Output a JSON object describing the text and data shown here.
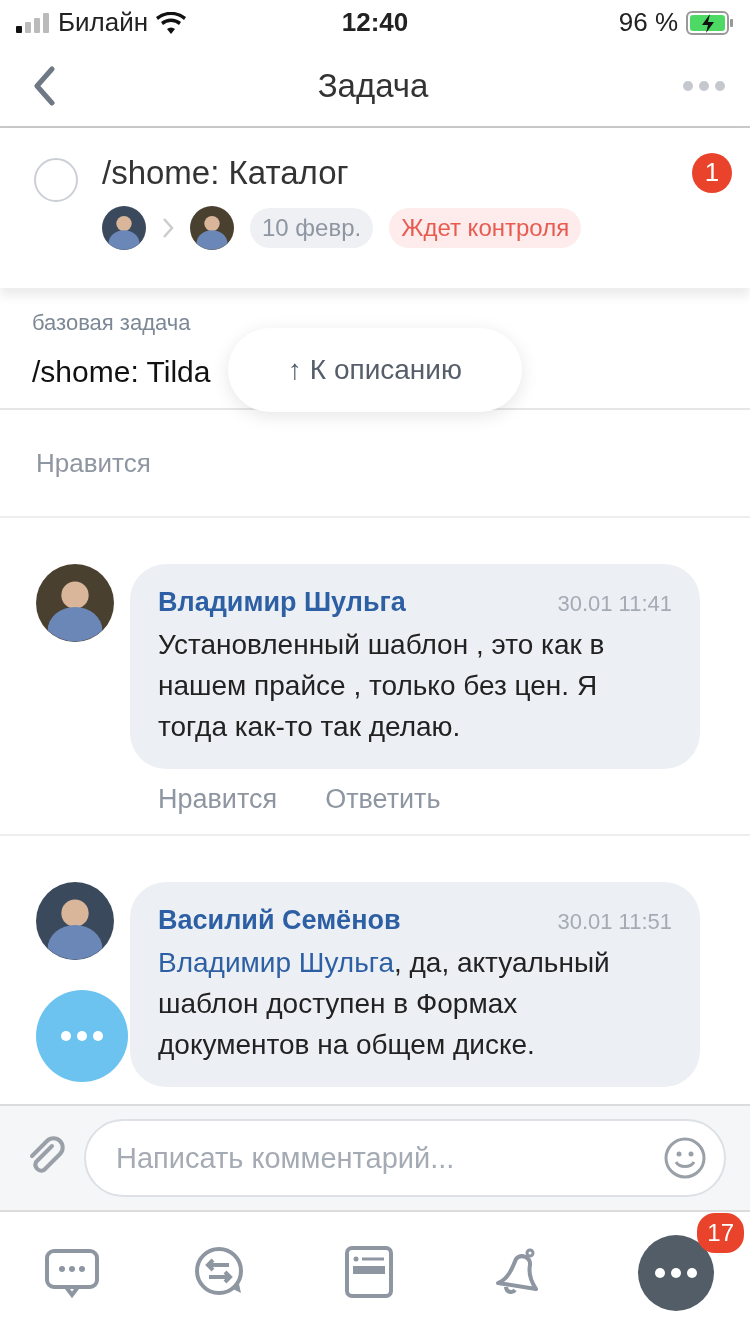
{
  "status_bar": {
    "carrier": "Билайн",
    "time": "12:40",
    "battery": "96 %"
  },
  "nav": {
    "title": "Задача"
  },
  "task": {
    "title": "/shome: Каталог",
    "done": false,
    "unread": "1",
    "date": "10 февр.",
    "status": "Ждет контроля"
  },
  "base_task": {
    "label": "базовая задача",
    "title": "/shome: Tilda"
  },
  "jump_button": {
    "label": "↑ К описанию"
  },
  "task_like": "Нравится",
  "comments": [
    {
      "author": "Владимир Шульга",
      "time": "30.01 11:41",
      "text": "Установленный шаблон , это как в нашем прайсе , только без цен. Я тогда как-то так делаю.",
      "actions": [
        "Нравится",
        "Ответить"
      ]
    },
    {
      "author": "Василий Семёнов",
      "time": "30.01 11:51",
      "mention": "Владимир Шульга",
      "text": ", да, актуальный шаблон доступен в Формах документов на общем диске."
    }
  ],
  "composer": {
    "placeholder": "Написать комментарий..."
  },
  "tab_bar": {
    "items": [
      {
        "kind": "chat"
      },
      {
        "kind": "exchange"
      },
      {
        "kind": "news"
      },
      {
        "kind": "bell"
      },
      {
        "kind": "more",
        "badge": "17"
      }
    ]
  }
}
